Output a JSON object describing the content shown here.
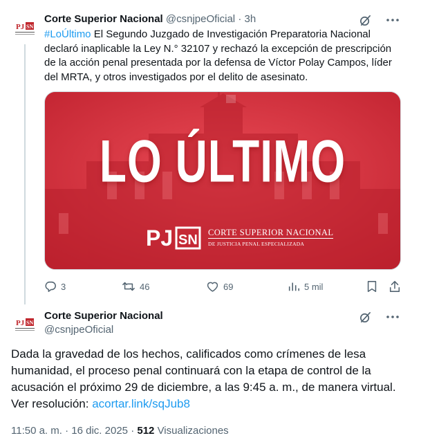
{
  "tweet1": {
    "author_name": "Corte Superior Nacional",
    "handle": "@csnjpeOficial",
    "separator": "·",
    "time": "3h",
    "hashtag": "#LoÚltimo",
    "text": " El Segundo Juzgado de Investigación Preparatoria Nacional declaró inaplicable la Ley N.° 32107 y rechazó la excepción de prescripción de la acción penal presentada por la defensa de Víctor Polay Campos, líder del MRTA, y otros investigados por el delito de asesinato.",
    "media": {
      "headline": "LO ÚLTIMO",
      "logo_mark": "PJSN",
      "logo_line1": "CORTE SUPERIOR NACIONAL",
      "logo_line2": "DE JUSTICIA PENAL ESPECIALIZADA"
    },
    "actions": {
      "replies": "3",
      "reposts": "46",
      "likes": "69",
      "views": "5 mil"
    }
  },
  "tweet2": {
    "author_name": "Corte Superior Nacional",
    "handle": "@csnjpeOficial",
    "text": "Dada la gravedad de los hechos, calificados como crímenes de lesa humanidad, el proceso penal continuará con la etapa de control de la acusación el próximo 29 de diciembre, a las 9:45 a. m., de manera virtual. Ver resolución: ",
    "link": "acortar.link/sqJub8",
    "time": "11:50 a. m.",
    "date": "16 dic. 2025",
    "views_count": "512",
    "views_label": "Visualizaciones",
    "separator": "·"
  },
  "colors": {
    "accent": "#1d9bf0",
    "muted": "#536471",
    "banner_red": "#d7303d"
  },
  "icons": [
    "grok-icon",
    "more-icon",
    "reply-icon",
    "repost-icon",
    "like-icon",
    "views-icon",
    "bookmark-icon",
    "share-icon"
  ]
}
